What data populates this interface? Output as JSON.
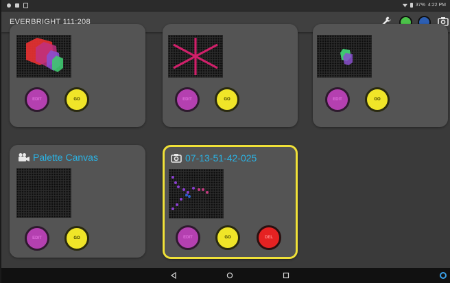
{
  "statusbar": {
    "battery": "37%",
    "time": "4:22 PM"
  },
  "app": {
    "title": "EVERBRIGHT 111:208"
  },
  "colors": {
    "edit": "#b440b0",
    "go": "#f0e528",
    "del": "#e52222",
    "accent": "#2ab4e6",
    "selected_border": "#f0e138"
  },
  "cards": [
    {
      "title": "",
      "icon": "",
      "buttons": [
        "EDIT",
        "GO"
      ]
    },
    {
      "title": "",
      "icon": "",
      "buttons": [
        "EDIT",
        "GO"
      ]
    },
    {
      "title": "",
      "icon": "",
      "buttons": [
        "EDIT",
        "GO"
      ]
    },
    {
      "title": "Palette Canvas",
      "icon": "video-camera-icon",
      "buttons": [
        "EDIT",
        "GO"
      ]
    },
    {
      "title": "07-13-51-42-025",
      "icon": "camera-icon",
      "buttons": [
        "EDIT",
        "GO",
        "DEL"
      ],
      "selected": true
    }
  ],
  "navbar": {
    "icons": [
      "back-icon",
      "home-icon",
      "recents-icon",
      "assistant-icon"
    ]
  }
}
